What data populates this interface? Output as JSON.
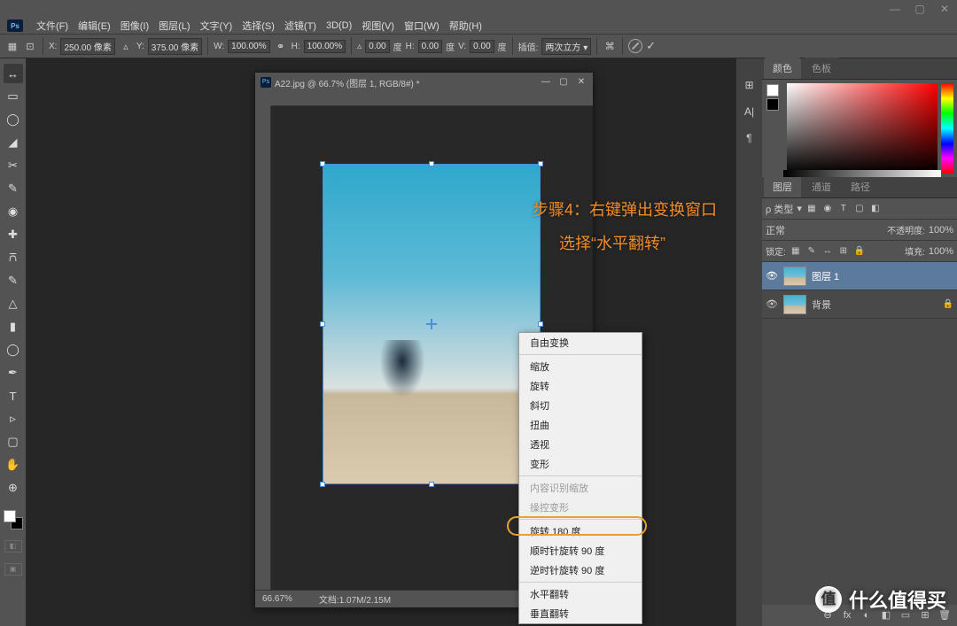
{
  "window_buttons": {
    "min": "—",
    "max": "▢",
    "close": "✕"
  },
  "menubar": {
    "logo": "Ps",
    "items": [
      "文件(F)",
      "编辑(E)",
      "图像(I)",
      "图层(L)",
      "文字(Y)",
      "选择(S)",
      "滤镜(T)",
      "3D(D)",
      "视图(V)",
      "窗口(W)",
      "帮助(H)"
    ]
  },
  "optbar": {
    "x_label": "X:",
    "x_val": "250.00 像素",
    "y_label": "Y:",
    "y_val": "375.00 像素",
    "w_label": "W:",
    "w_val": "100.00%",
    "h_label": "H:",
    "h_val": "100.00%",
    "angle_label": "▵",
    "angle_val": "0.00",
    "deg1": "度",
    "hskew_label": "H:",
    "hskew_val": "0.00",
    "deg2": "度",
    "vskew_label": "V:",
    "vskew_val": "0.00",
    "deg3": "度",
    "interp_label": "插值:",
    "interp_val": "两次立方 ▾"
  },
  "tools_glyphs": [
    "↔",
    "▭",
    "◯",
    "◢",
    "✂",
    "✎",
    "◉",
    "✚",
    "⩃",
    "✎",
    "△",
    "▮",
    "◯",
    "✒",
    "≡",
    "T",
    "▹",
    "▢",
    "✋",
    "⊕"
  ],
  "doc": {
    "title": "A22.jpg @ 66.7% (图层 1, RGB/8#) *",
    "zoom": "66.67%",
    "docinfo": "文档:1.07M/2.15M"
  },
  "annotation": {
    "line1": "步骤4：右键弹出变换窗口",
    "line2": "选择“水平翻转”"
  },
  "context_menu": {
    "items": [
      {
        "t": "自由变换",
        "d": false,
        "sep": false
      },
      {
        "t": "",
        "d": false,
        "sep": true
      },
      {
        "t": "缩放",
        "d": false,
        "sep": false
      },
      {
        "t": "旋转",
        "d": false,
        "sep": false
      },
      {
        "t": "斜切",
        "d": false,
        "sep": false
      },
      {
        "t": "扭曲",
        "d": false,
        "sep": false
      },
      {
        "t": "透视",
        "d": false,
        "sep": false
      },
      {
        "t": "变形",
        "d": false,
        "sep": false
      },
      {
        "t": "",
        "d": false,
        "sep": true
      },
      {
        "t": "内容识别缩放",
        "d": true,
        "sep": false
      },
      {
        "t": "操控变形",
        "d": true,
        "sep": false
      },
      {
        "t": "",
        "d": false,
        "sep": true
      },
      {
        "t": "旋转 180 度",
        "d": false,
        "sep": false
      },
      {
        "t": "顺时针旋转 90 度",
        "d": false,
        "sep": false
      },
      {
        "t": "逆时针旋转 90 度",
        "d": false,
        "sep": false
      },
      {
        "t": "",
        "d": false,
        "sep": true
      },
      {
        "t": "水平翻转",
        "d": false,
        "sep": false,
        "hl": true
      },
      {
        "t": "垂直翻转",
        "d": false,
        "sep": false
      }
    ]
  },
  "right_strip": [
    "⊞",
    "A|",
    "¶"
  ],
  "color_tabs": {
    "active": "颜色",
    "inactive": "色板"
  },
  "layers_tabs": {
    "active": "图层",
    "t2": "通道",
    "t3": "路径"
  },
  "layers_panel": {
    "kind": "ρ 类型",
    "kind_arrow": "▾",
    "filter_icons": [
      "▦",
      "◉",
      "T",
      "▢",
      "◧"
    ],
    "blend": "正常",
    "opacity_label": "不透明度:",
    "opacity_val": "100%",
    "lock_label": "锁定:",
    "lock_icons": [
      "▦",
      "✎",
      "↔",
      "⊞",
      "🔒"
    ],
    "fill_label": "填充:",
    "fill_val": "100%",
    "layers": [
      {
        "name": "图层 1",
        "selected": true,
        "locked": false
      },
      {
        "name": "背景",
        "selected": false,
        "locked": true
      }
    ],
    "footer_icons": [
      "⊖",
      "fx",
      "◐",
      "◧",
      "▭",
      "⊞",
      "🗑"
    ]
  },
  "watermark": {
    "icon": "值",
    "text": "什么值得买"
  }
}
